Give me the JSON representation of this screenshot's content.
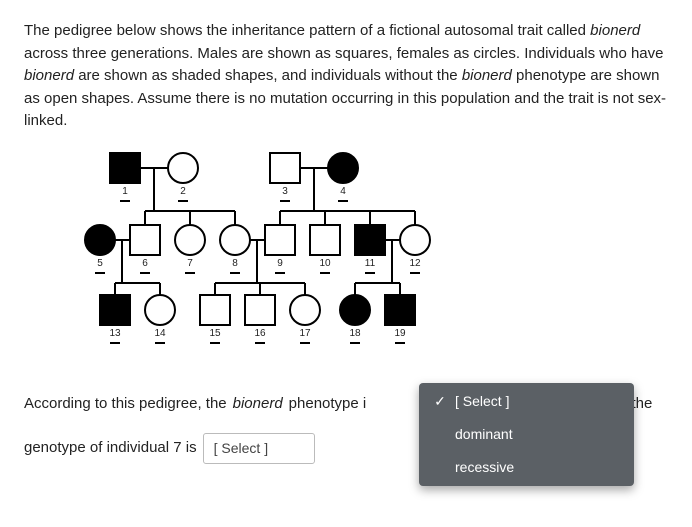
{
  "intro_parts": {
    "p1": "The pedigree below shows the inheritance pattern of a fictional autosomal trait called ",
    "trait": "bionerd",
    "p2": " across three generations. Males are shown as squares, females as circles. Individuals who have ",
    "p3": " are shown as shaded shapes, and individuals without the ",
    "p4": " phenotype are shown as open shapes. Assume there is no mutation occurring in this population and the trait is not sex-linked."
  },
  "pedigree": {
    "labels": [
      "1",
      "2",
      "3",
      "4",
      "5",
      "6",
      "7",
      "8",
      "9",
      "10",
      "11",
      "12",
      "13",
      "14",
      "15",
      "16",
      "17",
      "18",
      "19"
    ]
  },
  "question": {
    "q1a": "According to this pedigree, the ",
    "q1b": " phenotype i",
    "q1c": " and the",
    "q2a": "genotype of individual 7 is",
    "select_placeholder": "[ Select ]"
  },
  "dropdown": {
    "selected": "[ Select ]",
    "options": [
      "dominant",
      "recessive"
    ]
  }
}
